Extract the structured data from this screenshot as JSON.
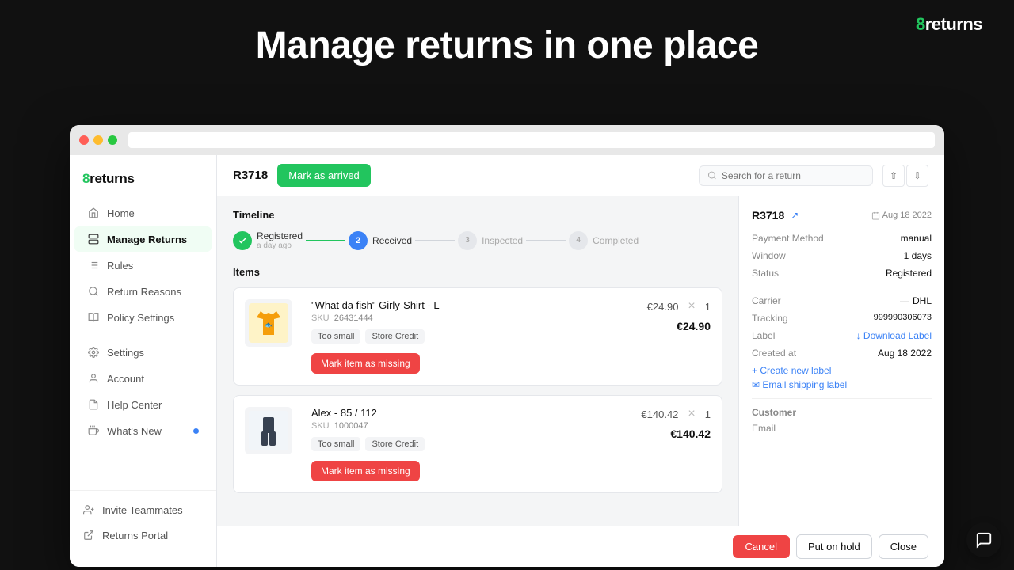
{
  "brand": {
    "name": "8returns",
    "prefix": "8",
    "suffix": "returns"
  },
  "hero": {
    "title": "Manage returns in one place"
  },
  "titlebar": {
    "url": ""
  },
  "sidebar": {
    "brand": "8returns",
    "nav_items": [
      {
        "id": "home",
        "label": "Home",
        "icon": "home"
      },
      {
        "id": "manage-returns",
        "label": "Manage Returns",
        "icon": "returns",
        "active": true
      },
      {
        "id": "rules",
        "label": "Rules",
        "icon": "rules"
      },
      {
        "id": "return-reasons",
        "label": "Return Reasons",
        "icon": "reasons"
      },
      {
        "id": "policy-settings",
        "label": "Policy Settings",
        "icon": "policy"
      },
      {
        "id": "settings",
        "label": "Settings",
        "icon": "settings"
      },
      {
        "id": "account",
        "label": "Account",
        "icon": "account"
      },
      {
        "id": "help-center",
        "label": "Help Center",
        "icon": "help"
      },
      {
        "id": "whats-new",
        "label": "What's New",
        "icon": "new",
        "has_dot": true
      }
    ],
    "bottom_items": [
      {
        "id": "invite-teammates",
        "label": "Invite Teammates",
        "icon": "invite"
      },
      {
        "id": "returns-portal",
        "label": "Returns Portal",
        "icon": "portal"
      }
    ]
  },
  "topbar": {
    "return_id": "R3718",
    "btn_arrived": "Mark as arrived",
    "search_placeholder": "Search for a return"
  },
  "timeline": {
    "title": "Timeline",
    "steps": [
      {
        "id": "registered",
        "label": "Registered",
        "sublabel": "a day ago",
        "num": "✓",
        "state": "done"
      },
      {
        "id": "received",
        "label": "Received",
        "num": "2",
        "state": "active"
      },
      {
        "id": "inspected",
        "label": "Inspected",
        "num": "3",
        "state": "pending"
      },
      {
        "id": "completed",
        "label": "Completed",
        "num": "4",
        "state": "pending"
      }
    ]
  },
  "items": {
    "title": "Items",
    "list": [
      {
        "id": "item1",
        "name": "\"What da fish\" Girly-Shirt - L",
        "sku_label": "SKU",
        "sku": "26431444",
        "tags": [
          "Too small",
          "Store Credit"
        ],
        "unit_price": "€24.90",
        "qty": "1",
        "total": "€24.90",
        "btn_label": "Mark item as missing",
        "img": "shirt-yellow"
      },
      {
        "id": "item2",
        "name": "Alex - 85 / 112",
        "sku_label": "SKU",
        "sku": "1000047",
        "tags": [
          "Too small",
          "Store Credit"
        ],
        "unit_price": "€140.42",
        "qty": "1",
        "total": "€140.42",
        "btn_label": "Mark item as missing",
        "img": "pants-dark"
      }
    ]
  },
  "right_panel": {
    "return_id": "R3718",
    "date": "Aug 18 2022",
    "meta": [
      {
        "key": "Payment Method",
        "val": "manual"
      },
      {
        "key": "Window",
        "val": "1 days"
      },
      {
        "key": "Status",
        "val": "Registered"
      }
    ],
    "carrier": {
      "key": "Carrier",
      "dash": "—",
      "val": "DHL"
    },
    "tracking": {
      "key": "Tracking",
      "val": "999990306073"
    },
    "label": {
      "key": "Label",
      "download": "↓ Download Label"
    },
    "created_at": {
      "key": "Created at",
      "val": "Aug 18 2022"
    },
    "create_new_label": "+ Create new label",
    "email_shipping_label": "✉ Email shipping label",
    "customer": {
      "title": "Customer",
      "email_label": "Email"
    }
  },
  "action_bar": {
    "cancel_label": "Cancel",
    "hold_label": "Put on hold",
    "close_label": "Close"
  }
}
